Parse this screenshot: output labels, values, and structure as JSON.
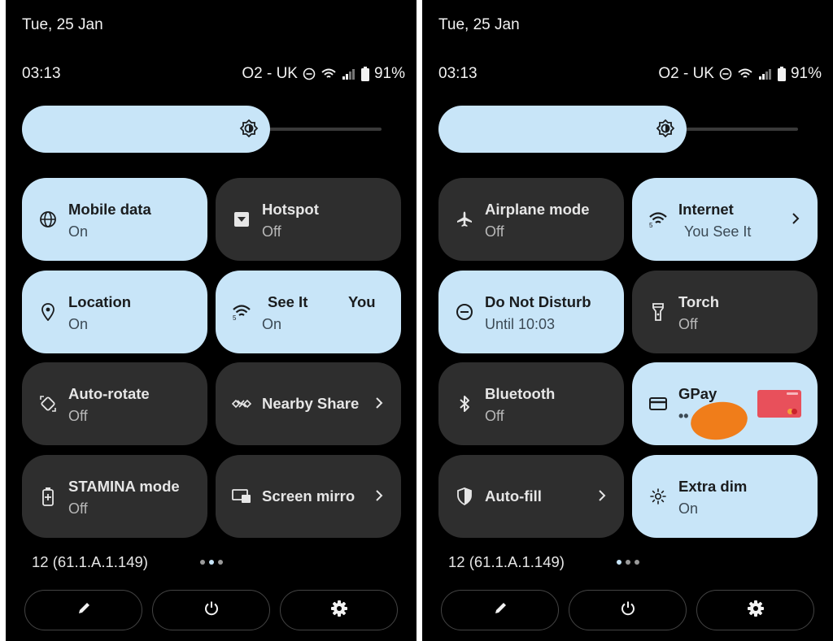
{
  "colors": {
    "panel_bg": "#000000",
    "tile_on": "#c8e5f8",
    "tile_off": "#2e2e2e",
    "gpay_redaction": "#f07d1a",
    "card": "#e8505b"
  },
  "left": {
    "date": "Tue, 25 Jan",
    "time": "03:13",
    "carrier": "O2 - UK",
    "battery": "91%",
    "brightness_level": 0.69,
    "tiles": [
      {
        "title": "Mobile data",
        "subtitle": "On",
        "icon": "globe-icon",
        "state": "on"
      },
      {
        "title": "Hotspot",
        "subtitle": "Off",
        "icon": "hotspot-icon",
        "state": "off"
      },
      {
        "title": "Location",
        "subtitle": "On",
        "icon": "location-pin-icon",
        "state": "on"
      },
      {
        "title": "See It",
        "title_right": "You",
        "subtitle": "On",
        "icon": "wifi-icon",
        "state": "on"
      },
      {
        "title": "Auto-rotate",
        "subtitle": "Off",
        "icon": "auto-rotate-icon",
        "state": "off"
      },
      {
        "title": "Nearby Share",
        "icon": "nearby-share-icon",
        "state": "off"
      },
      {
        "title": "STAMINA mode",
        "subtitle": "Off",
        "icon": "battery-saver-icon",
        "state": "off"
      },
      {
        "title": "Screen mirro",
        "icon": "screen-mirror-icon",
        "state": "off"
      }
    ],
    "build": "12 (61.1.A.1.149)",
    "page": {
      "current": 1,
      "total": 3
    }
  },
  "right": {
    "date": "Tue, 25 Jan",
    "time": "03:13",
    "carrier": "O2 - UK",
    "battery": "91%",
    "brightness_level": 0.69,
    "tiles": [
      {
        "title": "Airplane mode",
        "subtitle": "Off",
        "icon": "airplane-icon",
        "state": "off"
      },
      {
        "title": "Internet",
        "subtitle": "You See It",
        "icon": "wifi-icon",
        "state": "on"
      },
      {
        "title": "Do Not Disturb",
        "subtitle": "Until 10:03",
        "icon": "do-not-disturb-icon",
        "state": "on"
      },
      {
        "title": "Torch",
        "subtitle": "Off",
        "icon": "torch-icon",
        "state": "off"
      },
      {
        "title": "Bluetooth",
        "subtitle": "Off",
        "icon": "bluetooth-icon",
        "state": "off"
      },
      {
        "title": "GPay",
        "subtitle": "••",
        "icon": "card-icon",
        "state": "on"
      },
      {
        "title": "Auto-fill",
        "icon": "shield-icon",
        "state": "off"
      },
      {
        "title": "Extra dim",
        "subtitle": "On",
        "icon": "extra-dim-icon",
        "state": "on"
      }
    ],
    "build": "12 (61.1.A.1.149)",
    "page": {
      "current": 1,
      "total": 3
    }
  },
  "bottom_icons": [
    "edit-icon",
    "power-icon",
    "settings-icon"
  ]
}
